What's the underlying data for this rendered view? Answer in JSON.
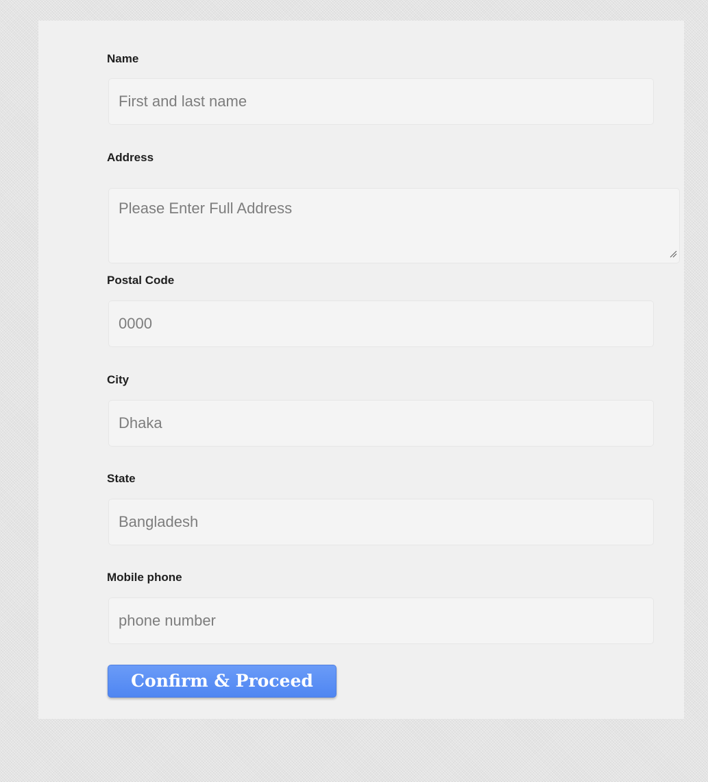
{
  "form": {
    "fields": {
      "name": {
        "label": "Name",
        "placeholder": "First and last name"
      },
      "address": {
        "label": "Address",
        "placeholder": "Please Enter Full Address"
      },
      "postal_code": {
        "label": "Postal Code",
        "placeholder": "0000"
      },
      "city": {
        "label": "City",
        "placeholder": "Dhaka"
      },
      "state": {
        "label": "State",
        "placeholder": "Bangladesh"
      },
      "mobile_phone": {
        "label": "Mobile phone",
        "placeholder": "phone number"
      }
    },
    "submit_label": "Confirm & Proceed"
  },
  "colors": {
    "button": "#5b8ff5",
    "panel": "#f0f0f0",
    "background": "#e4e4e4"
  }
}
